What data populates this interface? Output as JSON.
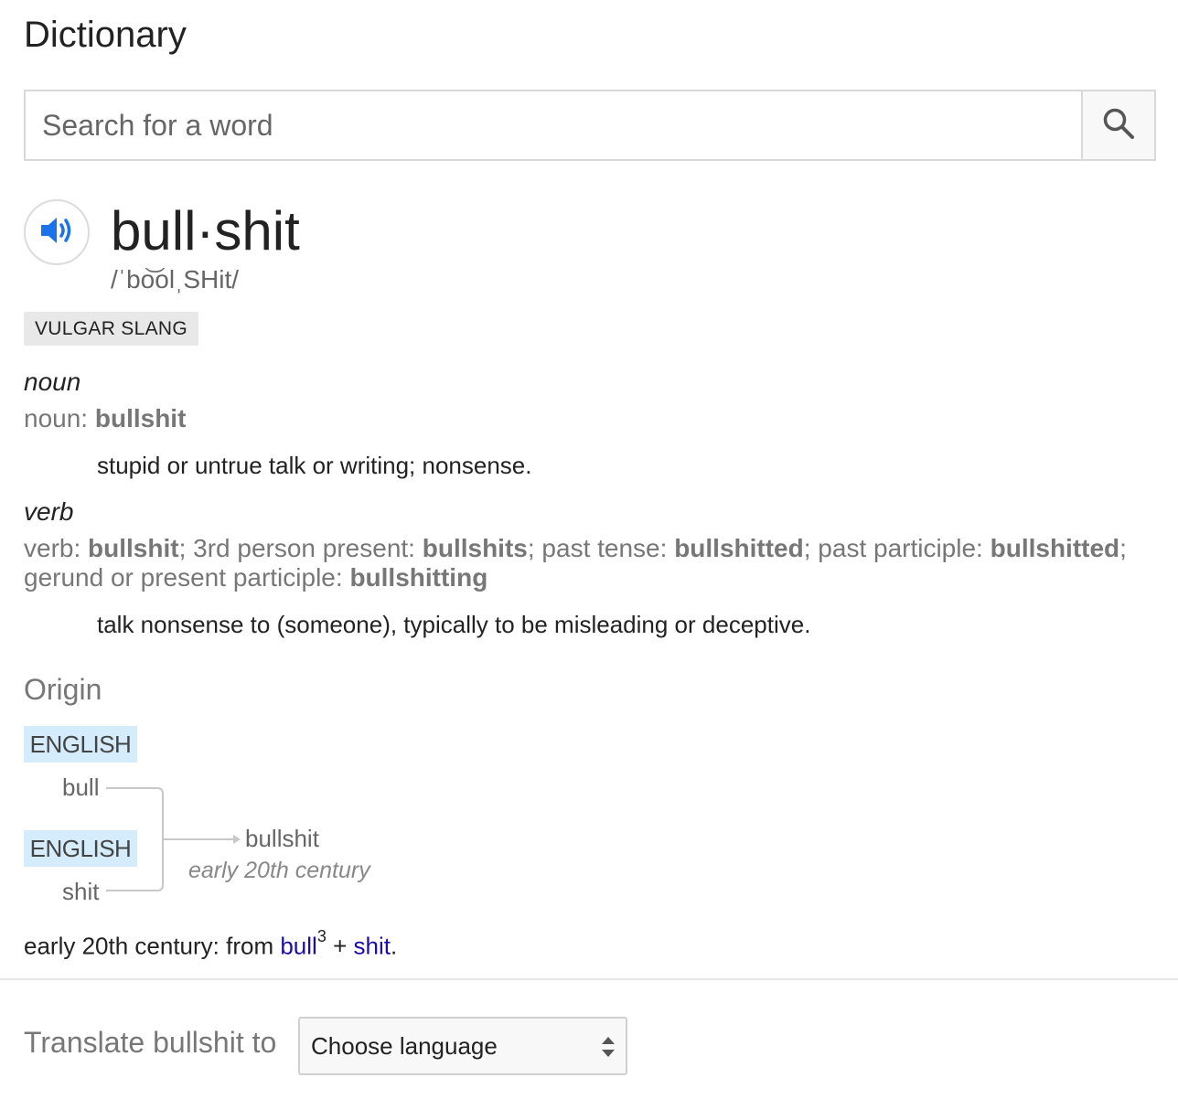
{
  "header": {
    "title": "Dictionary"
  },
  "search": {
    "placeholder": "Search for a word",
    "value": ""
  },
  "entry": {
    "headword": "bull·shit",
    "phonetic": "/ˈbo͝olˌSHit/",
    "register": "VULGAR SLANG",
    "senses": [
      {
        "pos": "noun",
        "forms_prefix": "noun: ",
        "forms_word": "bullshit",
        "definition": "stupid or untrue talk or writing; nonsense."
      },
      {
        "pos": "verb",
        "forms": [
          {
            "label": "verb: ",
            "word": "bullshit"
          },
          {
            "label": "; 3rd person present: ",
            "word": "bullshits"
          },
          {
            "label": "; past tense: ",
            "word": "bullshitted"
          },
          {
            "label": "; past participle: ",
            "word": "bullshitted"
          },
          {
            "label": "; gerund or present participle: ",
            "word": "bullshitting"
          }
        ],
        "definition": "talk nonsense to (someone), typically to be misleading or deceptive."
      }
    ]
  },
  "origin": {
    "heading": "Origin",
    "diagram": {
      "lang1": "ENGLISH",
      "word1": "bull",
      "lang2": "ENGLISH",
      "word2": "shit",
      "result": "bullshit",
      "period": "early 20th century"
    },
    "text_prefix": "early 20th century: from ",
    "link1": "bull",
    "link1_sup": "3",
    "joiner": " + ",
    "link2": "shit",
    "suffix": "."
  },
  "translate": {
    "label": "Translate bullshit to",
    "selected": "Choose language"
  },
  "icons": {
    "search": "search-icon",
    "speaker": "speaker-icon",
    "select": "select-arrows-icon"
  },
  "colors": {
    "link": "#1a0dab",
    "speaker": "#1a73e8",
    "lang_tag_bg": "#d4ecfb"
  }
}
